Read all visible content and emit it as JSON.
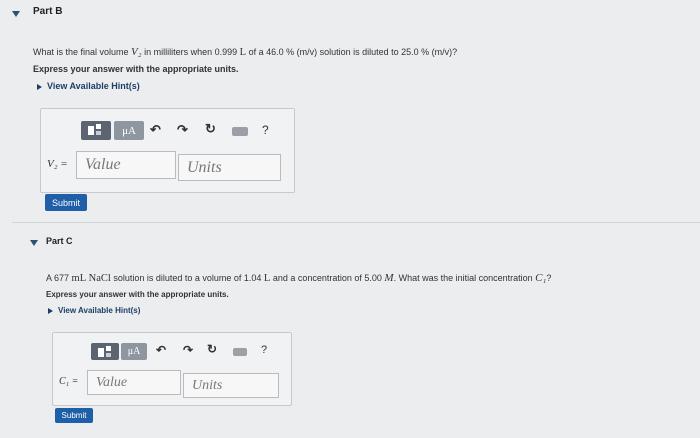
{
  "partB": {
    "title": "Part B",
    "question_pre": "What is the final volume ",
    "var": "V₂",
    "question_mid": " in milliliters when 0.999 ",
    "unit_L": "L",
    "question_post": " of a 46.0 % (m/v) solution is diluted to 25.0 % (m/v)?",
    "express": "Express your answer with the appropriate units.",
    "hints": "View Available Hint(s)",
    "toolbar": {
      "mu_label": "μA",
      "help": "?"
    },
    "var_label": "V₂ =",
    "value_placeholder": "Value",
    "units_placeholder": "Units",
    "submit": "Submit"
  },
  "partC": {
    "title": "Part C",
    "question_pre": "A 677 ",
    "mL": "mL",
    "nacl": "NaCl",
    "question_mid": " solution is diluted to a volume of 1.04 ",
    "unit_L": "L",
    "question_mid2": " and a concentration of 5.00 ",
    "unit_M": "M",
    "question_post": ". What was the initial concentration ",
    "var": "C₁",
    "question_end": "?",
    "express": "Express your answer with the appropriate units.",
    "hints": "View Available Hint(s)",
    "toolbar": {
      "mu_label": "μA",
      "help": "?"
    },
    "var_label": "C₁ =",
    "value_placeholder": "Value",
    "units_placeholder": "Units",
    "submit": "Submit"
  },
  "colors": {
    "submit": "#1f5fa8",
    "hint_link": "#1d3e66",
    "background": "#ecedef"
  }
}
